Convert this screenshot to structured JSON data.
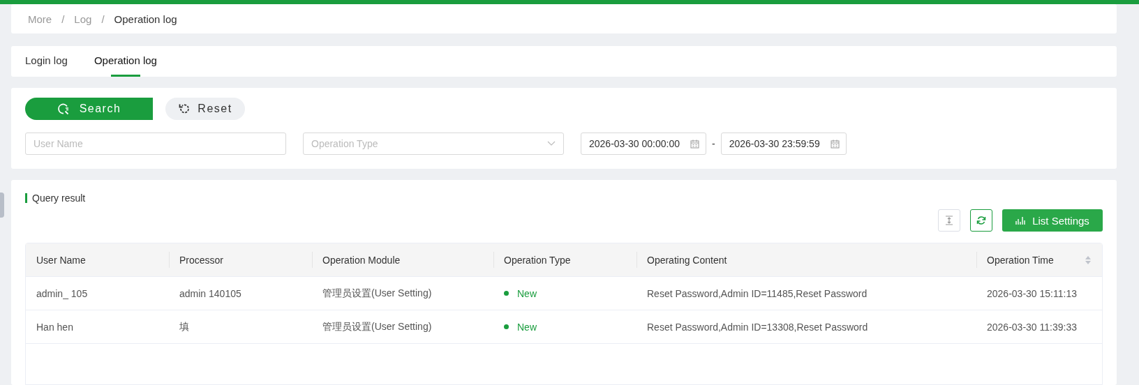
{
  "breadcrumb": [
    {
      "label": "More",
      "current": false
    },
    {
      "label": "Log",
      "current": false
    },
    {
      "label": "Operation log",
      "current": true
    }
  ],
  "breadcrumb_separator": "/",
  "tabs": [
    {
      "label": "Login log",
      "selected": false
    },
    {
      "label": "Operation log",
      "selected": true
    }
  ],
  "search_button": "Search",
  "reset_button": "Reset",
  "filters": {
    "user_name": {
      "placeholder": "User Name"
    },
    "operation_type": {
      "placeholder": "Operation Type"
    },
    "start_time": {
      "value": "2026-03-30 00:00:00"
    },
    "range_separator": "-",
    "end_time": {
      "value": "2026-03-30 23:59:59"
    }
  },
  "result_title": "Query result",
  "list_settings_button": "List Settings",
  "table": {
    "columns": [
      "User Name",
      "Processor",
      "Operation Module",
      "Operation Type",
      "Operating Content",
      "Operation Time"
    ],
    "rows": [
      {
        "cells": [
          "admin_ 105",
          "admin 140105",
          "管理员设置(User Setting)",
          "New",
          "Reset Password,Admin ID=11485,Reset Password",
          "2026-03-30 15:11:13"
        ],
        "color": "#1a9d3e"
      },
      {
        "cells": [
          "Han hen",
          "填",
          "管理员设置(User Setting)",
          "New",
          "Reset Password,Admin ID=13308,Reset Password",
          "2026-03-30 11:39:33"
        ],
        "color": "#1a9d3e"
      }
    ]
  }
}
